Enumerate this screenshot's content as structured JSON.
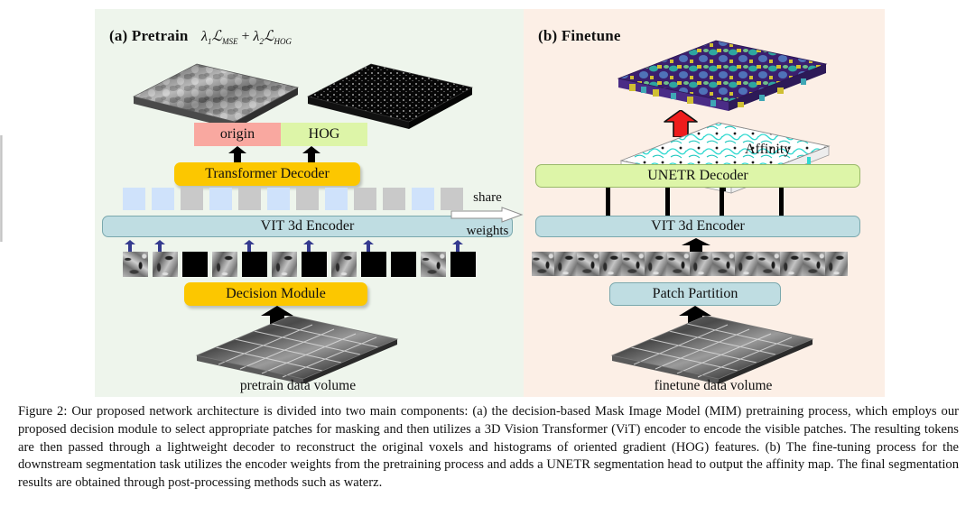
{
  "figure": {
    "panels": {
      "pretrain": {
        "label": "(a) Pretrain",
        "bg": "#eef5ec",
        "loss_formula": "λ₁ℒ_MSE + λ₂ℒ_HOG",
        "loss_parts": {
          "lambda1": "λ",
          "sub1": "1",
          "cal1": "ℒ",
          "mse": "MSE",
          "plus": "+",
          "lambda2": "λ",
          "sub2": "2",
          "cal2": "ℒ",
          "hog": "HOG"
        },
        "recon_targets": [
          {
            "label": "origin",
            "color": "#f9a8a0"
          },
          {
            "label": "HOG",
            "color": "#ddf5a8"
          }
        ],
        "decoder": {
          "label": "Transformer Decoder",
          "color": "#fcc700"
        },
        "encoder": {
          "label": "VIT 3d Encoder",
          "color": "#bfdde2"
        },
        "decision_module": {
          "label": "Decision Module",
          "color": "#fcc700"
        },
        "volume_label": "pretrain data volume",
        "tokens": [
          "blue",
          "blue",
          "gray",
          "blue",
          "gray",
          "blue",
          "gray",
          "blue",
          "gray",
          "gray",
          "blue",
          "gray"
        ],
        "patches": [
          "tex",
          "tex",
          "mask",
          "tex",
          "mask",
          "tex",
          "mask",
          "tex",
          "mask",
          "mask",
          "tex",
          "mask"
        ],
        "selection_marks": [
          0,
          1,
          3,
          5,
          7,
          10
        ],
        "token_colors": {
          "visible": "#cfe2fb",
          "masked": "#c9c9c9"
        }
      },
      "finetune": {
        "label": "(b) Finetune",
        "bg": "#fcefe6",
        "segmentation_volume": "segmentation-map",
        "affinity_label": "Affinity",
        "red_arrow_color": "#ee1c1c",
        "decoder": {
          "label": "UNETR Decoder",
          "color": "#ddf5a8"
        },
        "encoder": {
          "label": "VIT 3d Encoder",
          "color": "#bfdde2"
        },
        "patch_partition": {
          "label": "Patch Partition",
          "color": "#bfdde2"
        },
        "volume_label": "finetune data volume",
        "skip_connections": 4,
        "patch_count": 14
      }
    },
    "share": {
      "top": "share",
      "bottom": "weights"
    }
  },
  "caption": {
    "prefix": "Figure 2:",
    "text": "Our proposed network architecture is divided into two main components: (a) the decision-based Mask Image Model (MIM) pretraining process, which employs our proposed decision module to select appropriate patches for masking and then utilizes a 3D Vision Transformer (ViT) encoder to encode the visible patches. The resulting tokens are then passed through a lightweight decoder to reconstruct the original voxels and histograms of oriented gradient (HOG) features. (b) The fine-tuning process for the downstream segmentation task utilizes the encoder weights from the pretraining process and adds a UNETR segmentation head to output the affinity map. The final segmentation results are obtained through post-processing methods such as waterz."
  }
}
